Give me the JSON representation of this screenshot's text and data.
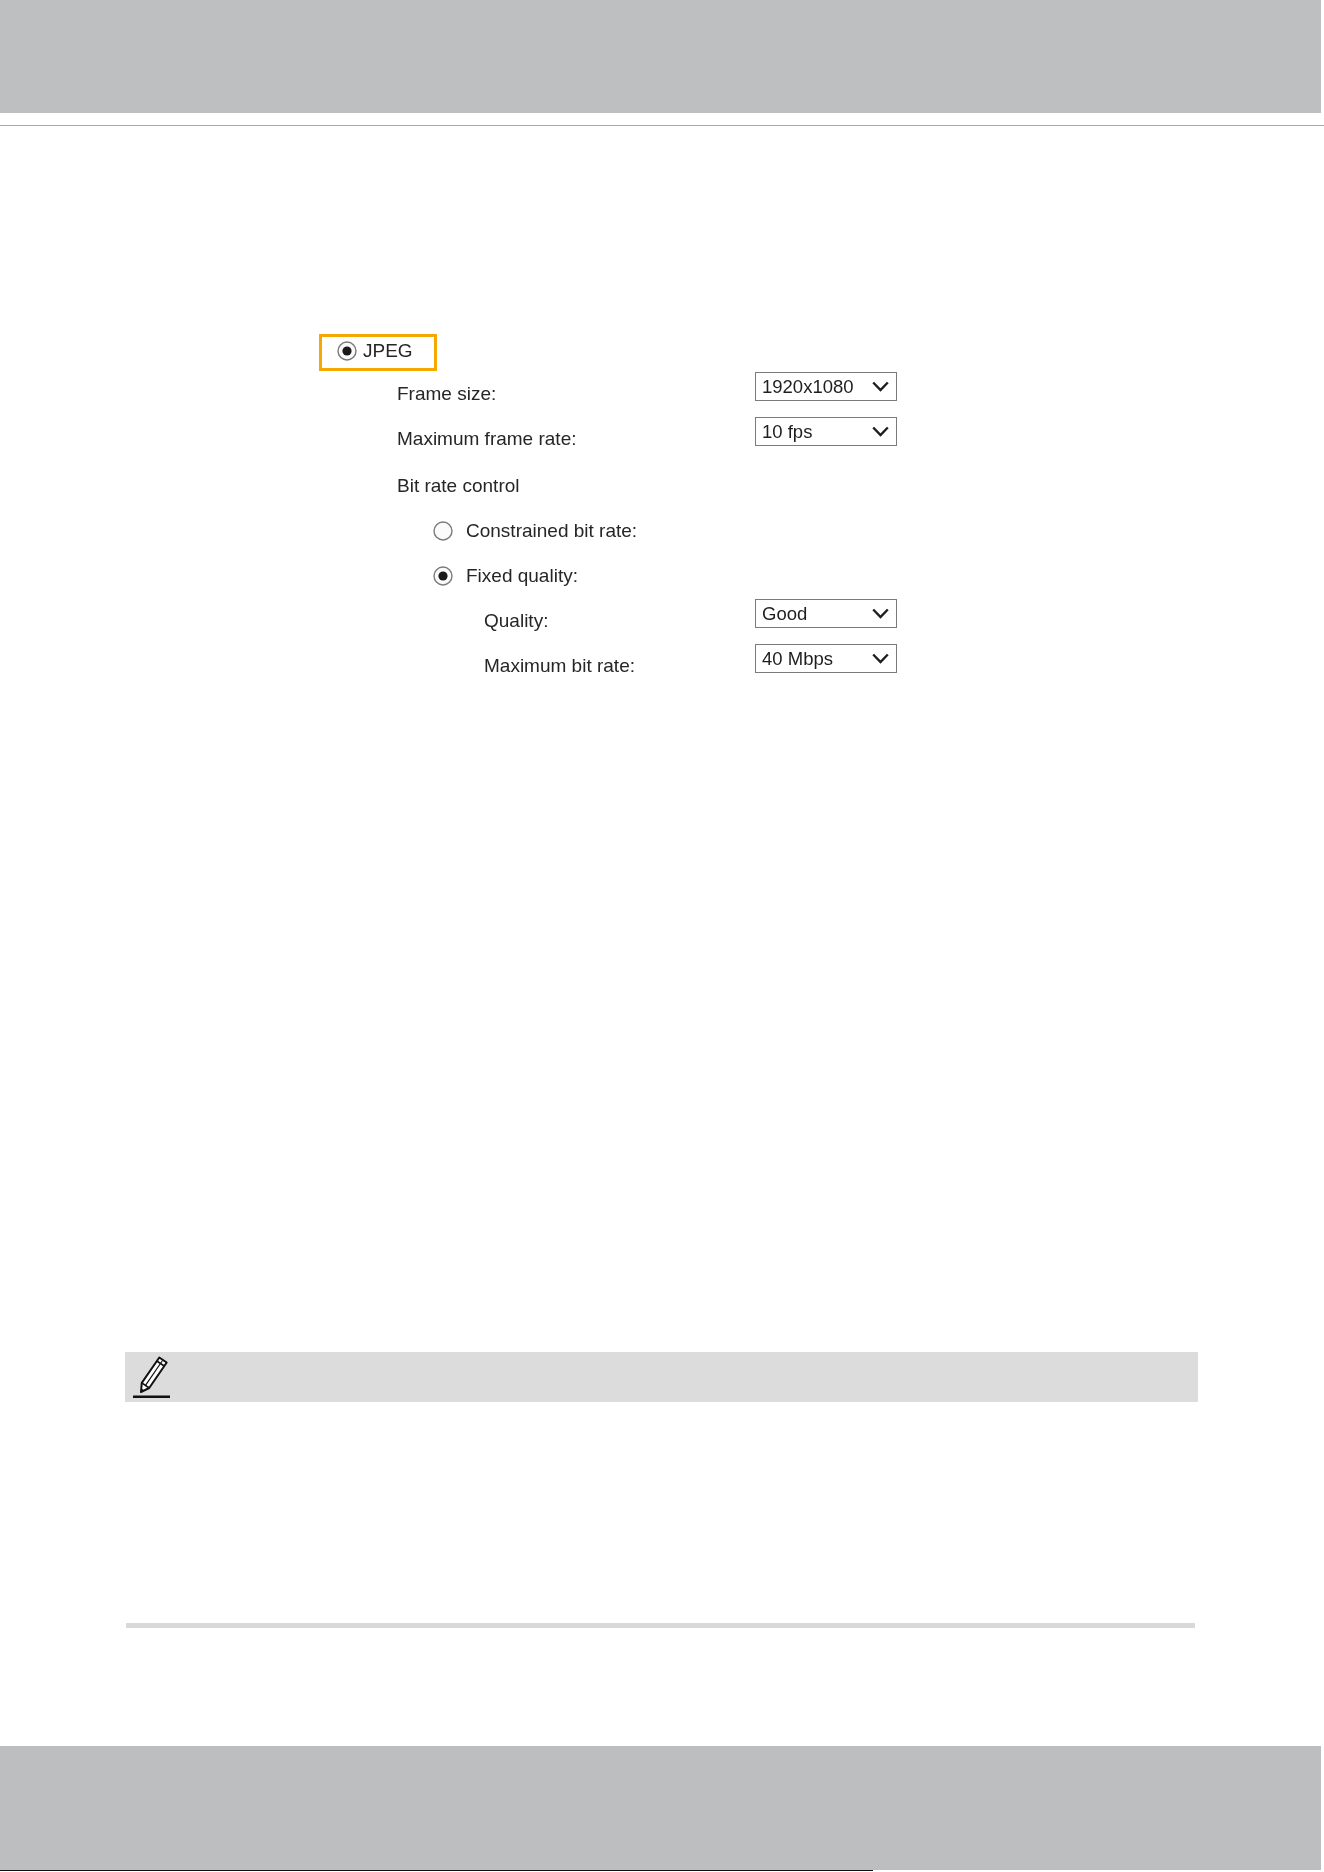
{
  "format_option": {
    "label": "JPEG",
    "selected": true,
    "highlighted": true
  },
  "settings": [
    {
      "label": "Frame size:",
      "value": "1920x1080"
    },
    {
      "label": "Maximum frame rate:",
      "value": "10 fps"
    }
  ],
  "bit_rate_control": {
    "label": "Bit rate control",
    "modes": [
      {
        "label": "Constrained bit rate:",
        "selected": false
      },
      {
        "label": "Fixed quality:",
        "selected": true,
        "settings": [
          {
            "label": "Quality:",
            "value": "Good"
          },
          {
            "label": "Maximum bit rate:",
            "value": "40 Mbps"
          }
        ]
      }
    ]
  }
}
